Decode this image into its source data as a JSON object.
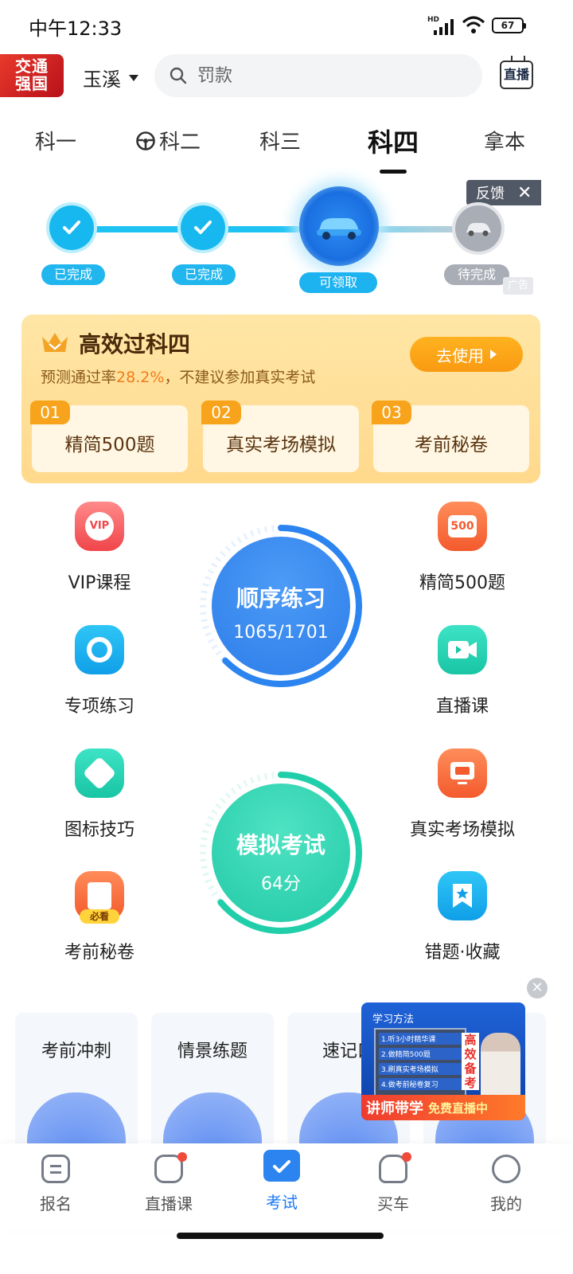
{
  "status": {
    "time": "中午12:33",
    "net": "HD",
    "battery": "67"
  },
  "header": {
    "logo_line1": "交通",
    "logo_line2": "强国",
    "city": "玉溪",
    "search_placeholder": "罚款",
    "live_label": "直播"
  },
  "tabs": [
    {
      "label": "科一"
    },
    {
      "label": "科二"
    },
    {
      "label": "科三"
    },
    {
      "label": "科四"
    },
    {
      "label": "拿本"
    }
  ],
  "progress": {
    "feedback": "反馈",
    "steps": [
      "已完成",
      "已完成",
      "可领取",
      "待完成"
    ],
    "ad": "广告"
  },
  "promo": {
    "title": "高效过科四",
    "sub_prefix": "预测通过率",
    "sub_rate": "28.2%",
    "sub_suffix": "，不建议参加真实考试",
    "cta": "去使用",
    "cards": [
      {
        "num": "01",
        "label": "精简500题"
      },
      {
        "num": "02",
        "label": "真实考场模拟"
      },
      {
        "num": "03",
        "label": "考前秘卷"
      }
    ]
  },
  "features": {
    "vip": "VIP课程",
    "vip_badge": "VIP",
    "jingjian": "精简500题",
    "jingjian_badge": "500",
    "zhuanxiang": "专项练习",
    "zhibo": "直播课",
    "tubiao": "图标技巧",
    "zhenshi": "真实考场模拟",
    "miju": "考前秘卷",
    "miju_badge": "必看",
    "cuoti": "错题·收藏"
  },
  "practice": {
    "title": "顺序练习",
    "value": "1065/1701",
    "progress": 0.626
  },
  "exam": {
    "title": "模拟考试",
    "value": "64分",
    "progress": 0.64
  },
  "bottom_cards": [
    {
      "label": "考前冲刺"
    },
    {
      "label": "情景练题"
    },
    {
      "label": "速记口"
    }
  ],
  "live_card": {
    "head": "学习方法",
    "board": [
      "1.听3小时精华课",
      "2.做精简500题",
      "3.刷真实考场模拟",
      "4.做考前秘卷复习"
    ],
    "tall": "高效备考",
    "banner_a": "讲师带学",
    "banner_b": "免费直播中"
  },
  "nav": [
    {
      "label": "报名"
    },
    {
      "label": "直播课"
    },
    {
      "label": "考试"
    },
    {
      "label": "买车"
    },
    {
      "label": "我的"
    }
  ],
  "colors": {
    "accent": "#1f7af3",
    "promo": "#ffd98c",
    "orange": "#f7a41c",
    "teal": "#25d0b0"
  }
}
